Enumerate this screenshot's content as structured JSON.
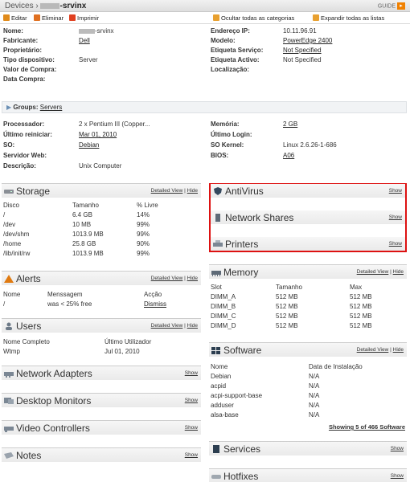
{
  "title": {
    "section": "Devices",
    "sep": "›",
    "device": "-srvinx",
    "guide": "GUIDE"
  },
  "toolbar": {
    "edit": "Editar",
    "delete": "Eliminar",
    "print": "Imprimir",
    "hide_all": "Ocultar todas as categorias",
    "expand_all": "Expandir todas as listas"
  },
  "info_left": [
    {
      "label": "Nome:",
      "value": "-srvinx",
      "link": false
    },
    {
      "label": "Fabricante:",
      "value": "Dell",
      "link": true
    },
    {
      "label": "Proprietário:",
      "value": "",
      "link": false
    },
    {
      "label": "Tipo dispositivo:",
      "value": "Server",
      "link": false
    },
    {
      "label": "Valor de Compra:",
      "value": "",
      "link": false
    },
    {
      "label": "Data Compra:",
      "value": "",
      "link": false
    }
  ],
  "info_right": [
    {
      "label": "Endereço IP:",
      "value": "10.11.96.91",
      "link": false
    },
    {
      "label": "Modelo:",
      "value": "PowerEdge 2400",
      "link": true
    },
    {
      "label": "Etiqueta Serviço:",
      "value": "Not Specified",
      "link": true
    },
    {
      "label": "Etiqueta Activo:",
      "value": "Not Specified",
      "link": false
    },
    {
      "label": "Localização:",
      "value": "",
      "link": false
    }
  ],
  "groups": {
    "label": "Groups:",
    "value": "Servers"
  },
  "hw_left": [
    {
      "label": "Processador:",
      "value": "2 x Pentium III (Copper...",
      "link": false
    },
    {
      "label": "Último reiniciar:",
      "value": "Mar 01, 2010",
      "link": true
    },
    {
      "label": "SO:",
      "value": "Debian",
      "link": true
    },
    {
      "label": "Servidor Web:",
      "value": "",
      "link": false
    },
    {
      "label": "Descrição:",
      "value": "Unix Computer",
      "link": false
    }
  ],
  "hw_right": [
    {
      "label": "Memória:",
      "value": "2 GB",
      "link": true
    },
    {
      "label": "Último Login:",
      "value": "",
      "link": false
    },
    {
      "label": "SO Kernel:",
      "value": "Linux 2.6.26-1-686",
      "link": false
    },
    {
      "label": "BIOS:",
      "value": "A06",
      "link": true
    }
  ],
  "links": {
    "detailed": "Detailed View",
    "hide": "Hide",
    "show": "Show"
  },
  "storage": {
    "title": "Storage",
    "headers": [
      "Disco",
      "Tamanho",
      "% Livre"
    ],
    "rows": [
      [
        "/",
        "6.4 GB",
        "14%"
      ],
      [
        "/dev",
        "10 MB",
        "99%"
      ],
      [
        "/dev/shm",
        "1013.9 MB",
        "99%"
      ],
      [
        "/home",
        "25.8 GB",
        "90%"
      ],
      [
        "/lib/init/rw",
        "1013.9 MB",
        "99%"
      ]
    ]
  },
  "alerts": {
    "title": "Alerts",
    "headers": [
      "Nome",
      "Menssagem",
      "Acção"
    ],
    "rows": [
      [
        "/",
        "was < 25% free",
        "Dismiss"
      ]
    ]
  },
  "users": {
    "title": "Users",
    "headers": [
      "Nome Completo",
      "Último Utilizador"
    ],
    "rows": [
      [
        "Wtmp",
        "Jul 01, 2010"
      ]
    ]
  },
  "left_collapsed": [
    "Network Adapters",
    "Desktop Monitors",
    "Video Controllers",
    "Notes"
  ],
  "right_highlighted": [
    "AntiVirus",
    "Network Shares",
    "Printers"
  ],
  "memory": {
    "title": "Memory",
    "headers": [
      "Slot",
      "Tamanho",
      "Max"
    ],
    "rows": [
      [
        "DIMM_A",
        "512 MB",
        "512 MB"
      ],
      [
        "DIMM_B",
        "512 MB",
        "512 MB"
      ],
      [
        "DIMM_C",
        "512 MB",
        "512 MB"
      ],
      [
        "DIMM_D",
        "512 MB",
        "512 MB"
      ]
    ]
  },
  "software": {
    "title": "Software",
    "headers": [
      "Nome",
      "Data de Instalação"
    ],
    "rows": [
      [
        "Debian",
        "N/A"
      ],
      [
        "acpid",
        "N/A"
      ],
      [
        "acpi-support-base",
        "N/A"
      ],
      [
        "adduser",
        "N/A"
      ],
      [
        "alsa-base",
        "N/A"
      ]
    ],
    "footer": "Showing 5 of 466 Software"
  },
  "right_collapsed": [
    "Services",
    "Hotfixes"
  ],
  "colors": {
    "accent": "#f08000",
    "highlight": "#dd1111"
  }
}
